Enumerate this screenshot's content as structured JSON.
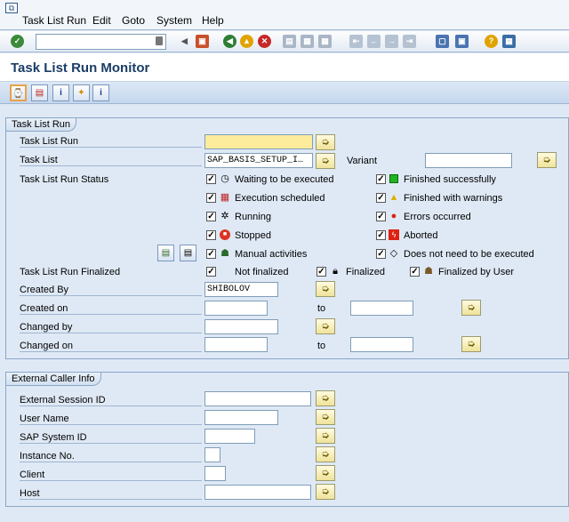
{
  "menu": {
    "items": [
      "Task List Run",
      "Edit",
      "Goto",
      "System",
      "Help"
    ]
  },
  "page_title": "Task List Run Monitor",
  "selection": {
    "group_title": "Task List Run",
    "task_list_run_label": "Task List Run",
    "task_list_run_value": "",
    "task_list_label": "Task List",
    "task_list_value": "SAP_BASIS_SETUP_I…",
    "variant_label": "Variant",
    "variant_value": "",
    "status_label": "Task List Run Status",
    "status_left": [
      "Waiting to be executed",
      "Execution scheduled",
      "Running",
      "Stopped",
      "Manual activities"
    ],
    "status_right": [
      "Finished successfully",
      "Finished with warnings",
      "Errors occurred",
      "Aborted",
      "Does not need to be executed"
    ],
    "finalized_label": "Task List Run Finalized",
    "finalized_options": [
      "Not finalized",
      "Finalized",
      "Finalized by User"
    ],
    "created_by_label": "Created By",
    "created_by_value": "SHIBOLOV",
    "created_on_label": "Created on",
    "changed_by_label": "Changed by",
    "changed_on_label": "Changed on",
    "to_label": "to"
  },
  "external": {
    "group_title": "External Caller Info",
    "fields": [
      "External Session ID",
      "User Name",
      "SAP System ID",
      "Instance No.",
      "Client",
      "Host"
    ]
  }
}
